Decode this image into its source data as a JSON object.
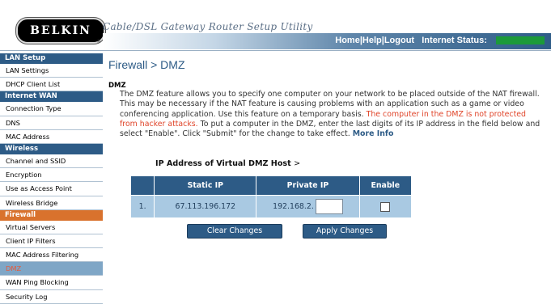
{
  "header": {
    "logo": "BELKIN",
    "registered_mark": "®",
    "app_title": "Cable/DSL Gateway Router Setup Utility",
    "nav": {
      "home": "Home",
      "sep1": "|",
      "help": "Help",
      "sep2": "|",
      "logout": "Logout"
    },
    "internet_status_label": "Internet Status:"
  },
  "sidebar": {
    "sections": [
      {
        "label": "LAN Setup",
        "items": [
          "LAN Settings",
          "DHCP Client List"
        ]
      },
      {
        "label": "Internet WAN",
        "items": [
          "Connection Type",
          "DNS",
          "MAC Address"
        ]
      },
      {
        "label": "Wireless",
        "items": [
          "Channel and SSID",
          "Encryption",
          "Use as Access Point",
          "Wireless Bridge"
        ]
      },
      {
        "label": "Firewall",
        "items": [
          "Virtual Servers",
          "Client IP Filters",
          "MAC Address Filtering",
          "DMZ",
          "WAN Ping Blocking",
          "Security Log"
        ]
      }
    ]
  },
  "main": {
    "title": "Firewall > DMZ",
    "section_label": "DMZ",
    "desc_normal": "The DMZ feature allows you to specify one computer on your network to be placed outside of the NAT firewall. This may be necessary if the NAT feature is causing problems with an application such as a game or video conferencing application. Use this feature on a temporary basis.",
    "desc_warning": "The computer in the DMZ is not protected from hacker attacks.",
    "desc_rest": "To put a computer in the DMZ, enter the last digits of its IP address in the field below and select \"Enable\". Click \"Submit\" for the change to take effect.",
    "more_info": "More Info",
    "host_label": "IP Address of Virtual DMZ Host",
    "host_label_suffix": ">",
    "table": {
      "headers": [
        "Static IP",
        "Private IP",
        "Enable"
      ],
      "row": {
        "index": "1.",
        "static_ip": "67.113.196.172",
        "private_ip_prefix": "192.168.2.",
        "private_ip_value": ""
      }
    },
    "buttons": {
      "clear": "Clear Changes",
      "apply": "Apply Changes"
    }
  }
}
